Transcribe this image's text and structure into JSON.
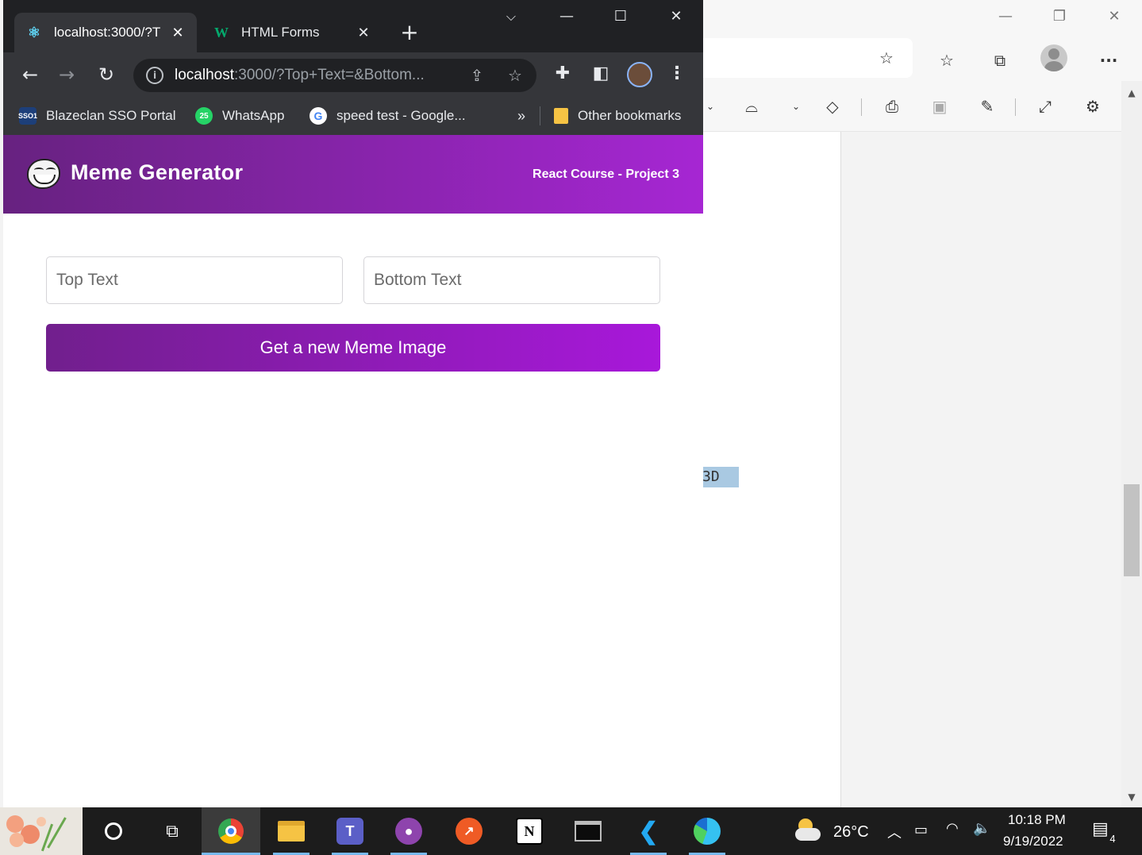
{
  "chrome": {
    "tabs": [
      {
        "title": "localhost:3000/?T",
        "active": true
      },
      {
        "title": "HTML Forms",
        "active": false
      }
    ],
    "url": {
      "host": "localhost",
      "rest": ":3000/?Top+Text=&Bottom..."
    },
    "bookmarks": [
      {
        "label": "Blazeclan SSO Portal",
        "icon": "SSO1"
      },
      {
        "label": "WhatsApp",
        "icon": "25"
      },
      {
        "label": "speed test - Google...",
        "icon": "G"
      }
    ],
    "more_bookmarks": "»",
    "other_bookmarks": "Other bookmarks"
  },
  "app": {
    "title": "Meme Generator",
    "subtitle": "React Course - Project 3",
    "top_text_placeholder": "Top Text",
    "bottom_text_placeholder": "Bottom Text",
    "button_label": "Get a new Meme Image",
    "gradient_start": "#672280",
    "gradient_end": "#A626D3"
  },
  "pdf_viewer": {
    "highlight_text": "3D"
  },
  "taskbar": {
    "weather": "26°C",
    "time": "10:18 PM",
    "date": "9/19/2022",
    "notification_count": "4"
  }
}
